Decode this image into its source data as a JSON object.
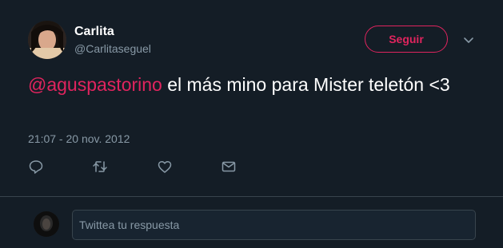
{
  "author": {
    "name": "Carlita",
    "handle": "@Carlitaseguel"
  },
  "follow_button": {
    "label": "Seguir"
  },
  "tweet": {
    "mention": "@aguspastorino",
    "text": " el más mino para Mister teletón <3",
    "timestamp": "21:07 - 20 nov. 2012"
  },
  "actions": [
    {
      "icon": "reply-icon"
    },
    {
      "icon": "retweet-icon"
    },
    {
      "icon": "like-icon"
    },
    {
      "icon": "direct-message-icon"
    }
  ],
  "reply": {
    "placeholder": "Twittea tu respuesta"
  },
  "colors": {
    "background": "#141d26",
    "accent": "#e0245e",
    "secondary_text": "#8899a6",
    "border": "#38444d"
  }
}
